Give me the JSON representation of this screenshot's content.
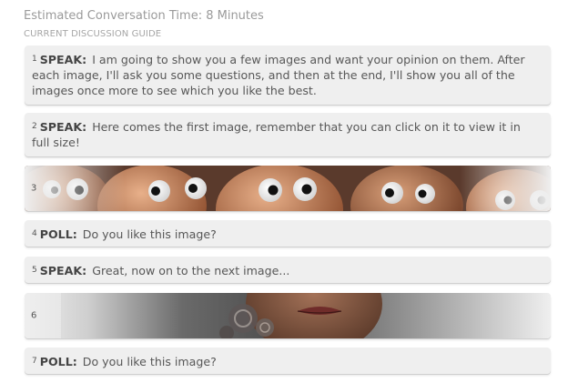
{
  "header": {
    "estimated_time": "Estimated Conversation Time: 8 Minutes",
    "guide_label": "CURRENT DISCUSSION GUIDE"
  },
  "items": [
    {
      "num": "1",
      "kind": "SPEAK:",
      "text": "I am going to show you a few images and want your opinion on them. After each image, I'll ask you some questions, and then at the end, I'll show you all of the images once more to see which you like the best."
    },
    {
      "num": "2",
      "kind": "SPEAK:",
      "text": "Here comes the first image, remember that you can click on it to view it in full size!"
    },
    {
      "num": "3",
      "kind": "image",
      "image": "eggs-with-googly-eyes-image"
    },
    {
      "num": "4",
      "kind": "POLL:",
      "text": "Do you like this image?"
    },
    {
      "num": "5",
      "kind": "SPEAK:",
      "text": "Great, now on to the next image..."
    },
    {
      "num": "6",
      "kind": "image",
      "image": "woman-portrait-image"
    },
    {
      "num": "7",
      "kind": "POLL:",
      "text": "Do you like this image?"
    }
  ]
}
